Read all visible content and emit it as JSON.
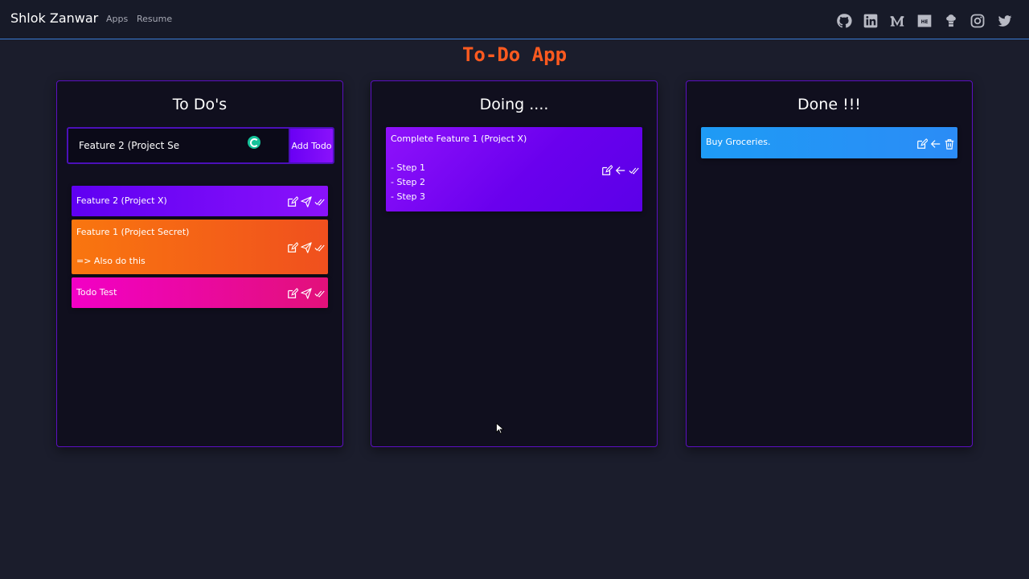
{
  "nav": {
    "brand": "Shlok Zanwar",
    "links": [
      "Apps",
      "Resume"
    ],
    "social_icons": [
      "github-icon",
      "linkedin-icon",
      "medium-icon",
      "hackerearth-icon",
      "chef-icon",
      "instagram-icon",
      "twitter-icon"
    ]
  },
  "title": "To-Do App",
  "colors": {
    "accent": "#ff5a1f",
    "column_border": "#5c0fc2",
    "nav_border": "#3a7bd5"
  },
  "columns": {
    "todo": {
      "title": "To Do's",
      "input_value": "Feature 2 (Project Se",
      "add_button": "Add Todo",
      "cards": [
        {
          "text": "Feature 2 (Project X)",
          "actions": [
            "edit-icon",
            "send-icon",
            "check-icon"
          ]
        },
        {
          "text": "Feature 1 (Project Secret)\n\n=> Also do this",
          "actions": [
            "edit-icon",
            "send-icon",
            "check-icon"
          ]
        },
        {
          "text": "Todo Test",
          "actions": [
            "edit-icon",
            "send-icon",
            "check-icon"
          ]
        }
      ]
    },
    "doing": {
      "title": "Doing ....",
      "cards": [
        {
          "text": "Complete Feature 1 (Project X)\n\n- Step 1\n- Step 2\n- Step 3",
          "actions": [
            "edit-icon",
            "arrow-left-icon",
            "check-icon"
          ]
        }
      ]
    },
    "done": {
      "title": "Done !!!",
      "cards": [
        {
          "text": "Buy Groceries.",
          "actions": [
            "edit-icon",
            "arrow-left-icon",
            "trash-icon"
          ]
        }
      ]
    }
  }
}
